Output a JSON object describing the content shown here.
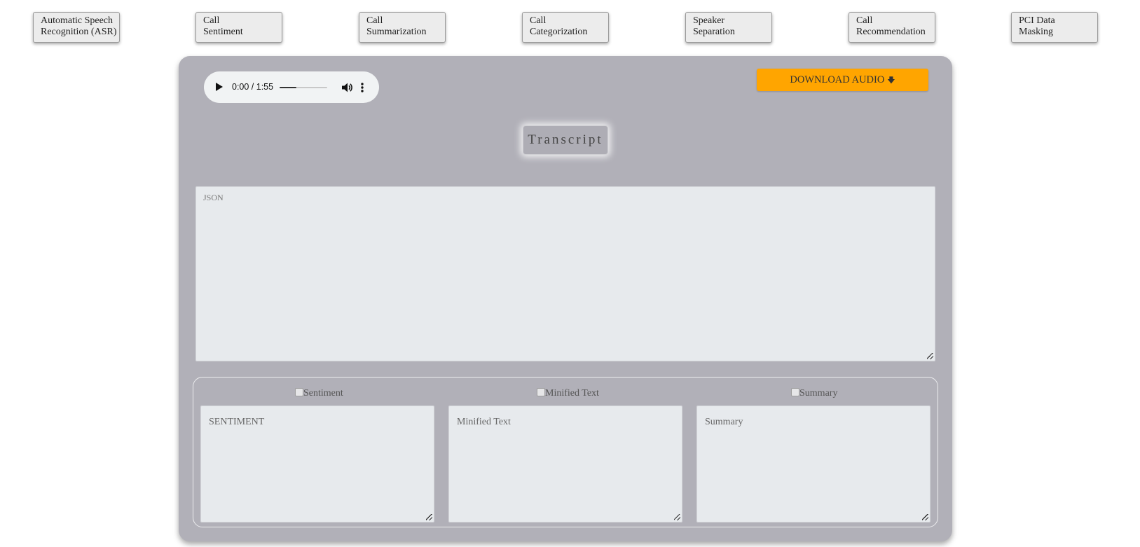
{
  "nav": [
    {
      "line1": "Automatic Speech",
      "line2": "Recognition (ASR)"
    },
    {
      "line1": "Call",
      "line2": "Sentiment"
    },
    {
      "line1": "Call",
      "line2": "Summarization"
    },
    {
      "line1": "Call",
      "line2": "Categorization"
    },
    {
      "line1": "Speaker",
      "line2": "Separation"
    },
    {
      "line1": "Call",
      "line2": "Recommendation"
    },
    {
      "line1": "PCI Data",
      "line2": "Masking"
    }
  ],
  "audio": {
    "time": "0:00 / 1:55",
    "progress": 0.35
  },
  "download_label": "DOWNLOAD AUDIO",
  "download_icon": "download-arrow-icon",
  "transcript_label": "Transcript",
  "json_placeholder": "JSON",
  "checks": {
    "sentiment": "Sentiment",
    "minified": "Minified Text",
    "summary": "Summary"
  },
  "boxes": {
    "sentiment": "SENTIMENT",
    "minified": "Minified Text",
    "summary": "Summary"
  },
  "colors": {
    "accent": "#ffa500",
    "panel": "#b1b0b8"
  }
}
